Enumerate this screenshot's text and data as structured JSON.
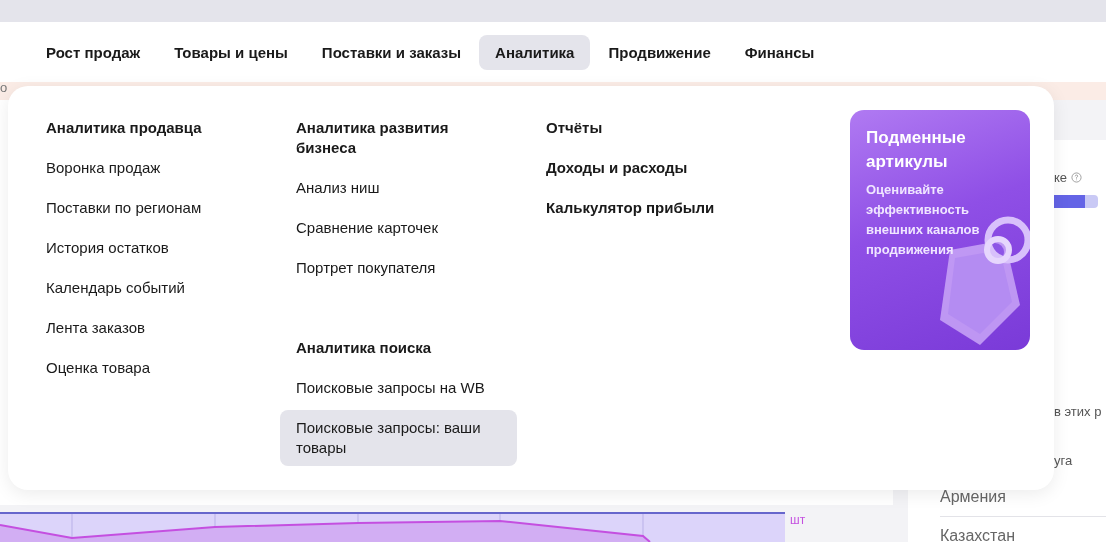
{
  "top_nav": [
    {
      "label": "Рост продаж",
      "selected": false
    },
    {
      "label": "Товары и цены",
      "selected": false
    },
    {
      "label": "Поставки и заказы",
      "selected": false
    },
    {
      "label": "Аналитика",
      "selected": true
    },
    {
      "label": "Продвижение",
      "selected": false
    },
    {
      "label": "Финансы",
      "selected": false
    }
  ],
  "menu": {
    "columns": [
      {
        "groups": [
          [
            {
              "kind": "heading",
              "label": "Аналитика продавца",
              "selected": false
            },
            {
              "kind": "link",
              "label": "Воронка продаж",
              "selected": false
            },
            {
              "kind": "link",
              "label": "Поставки по регионам",
              "selected": false
            },
            {
              "kind": "link",
              "label": "История остатков",
              "selected": false
            },
            {
              "kind": "link",
              "label": "Календарь событий",
              "selected": false
            },
            {
              "kind": "link",
              "label": "Лента заказов",
              "selected": false
            },
            {
              "kind": "link",
              "label": "Оценка товара",
              "selected": false
            }
          ]
        ]
      },
      {
        "groups": [
          [
            {
              "kind": "heading",
              "label": "Аналитика развития бизнеса",
              "selected": false
            },
            {
              "kind": "link",
              "label": "Анализ ниш",
              "selected": false
            },
            {
              "kind": "link",
              "label": "Сравнение карточек",
              "selected": false
            },
            {
              "kind": "link",
              "label": "Портрет покупателя",
              "selected": false
            }
          ],
          [
            {
              "kind": "heading",
              "label": "Аналитика поиска",
              "selected": false
            },
            {
              "kind": "link",
              "label": "Поисковые запросы на WB",
              "selected": false
            },
            {
              "kind": "link",
              "label": "Поисковые запросы: ваши товары",
              "selected": true
            }
          ]
        ]
      },
      {
        "groups": [
          [
            {
              "kind": "heading",
              "label": "Отчёты",
              "selected": false
            },
            {
              "kind": "heading",
              "label": "Доходы и расходы",
              "selected": false
            },
            {
              "kind": "heading",
              "label": "Калькулятор прибыли",
              "selected": false
            }
          ]
        ]
      }
    ],
    "promo": {
      "title": "Подменные артикулы",
      "text": "Оценивайте эффективность внешних каналов продвижения"
    }
  },
  "background": {
    "left_fragments": [
      "о"
    ],
    "right_fragments": [
      {
        "kind": "help",
        "text": "ке"
      },
      {
        "kind": "bar",
        "level": 0.85
      },
      {
        "kind": "cut",
        "text": "в этих р"
      },
      {
        "kind": "cut",
        "text": "уга"
      },
      {
        "kind": "country",
        "text": "Армения"
      },
      {
        "kind": "country",
        "text": "Казахстан"
      }
    ],
    "chart_unit": "шт"
  }
}
